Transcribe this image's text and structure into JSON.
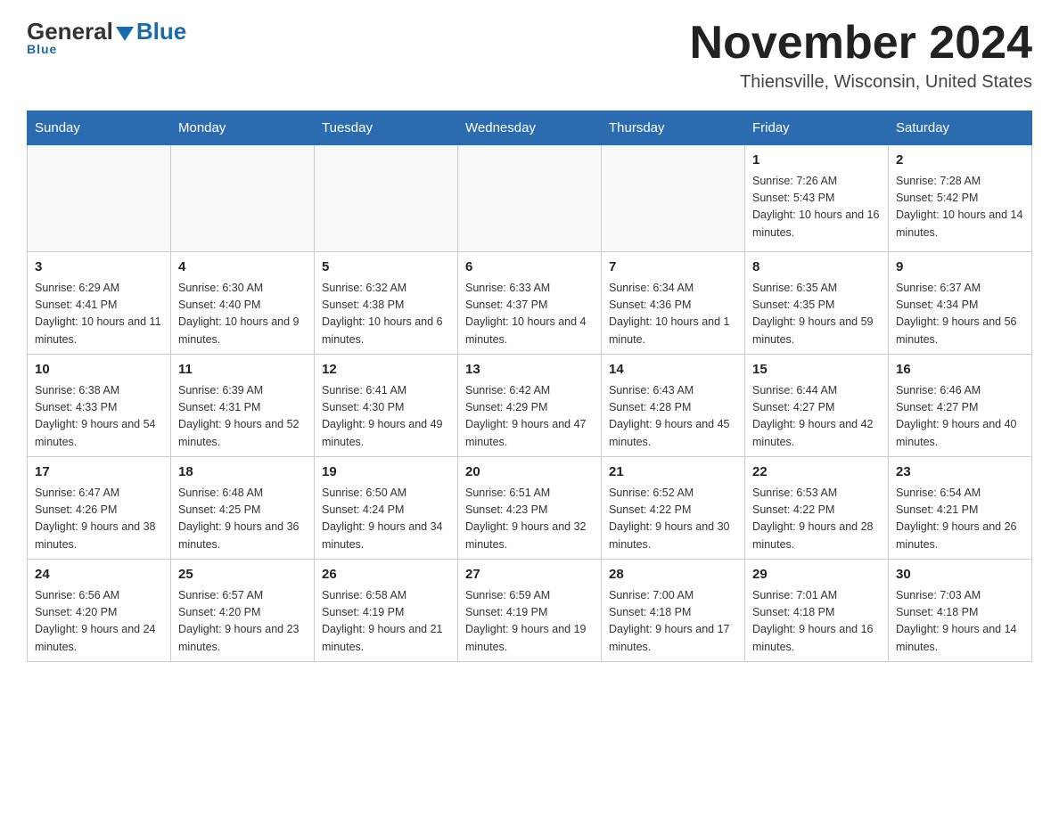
{
  "header": {
    "logo_general": "General",
    "logo_blue": "Blue",
    "month_title": "November 2024",
    "location": "Thiensville, Wisconsin, United States"
  },
  "days_of_week": [
    "Sunday",
    "Monday",
    "Tuesday",
    "Wednesday",
    "Thursday",
    "Friday",
    "Saturday"
  ],
  "weeks": [
    [
      {
        "day": "",
        "info": ""
      },
      {
        "day": "",
        "info": ""
      },
      {
        "day": "",
        "info": ""
      },
      {
        "day": "",
        "info": ""
      },
      {
        "day": "",
        "info": ""
      },
      {
        "day": "1",
        "info": "Sunrise: 7:26 AM\nSunset: 5:43 PM\nDaylight: 10 hours and 16 minutes."
      },
      {
        "day": "2",
        "info": "Sunrise: 7:28 AM\nSunset: 5:42 PM\nDaylight: 10 hours and 14 minutes."
      }
    ],
    [
      {
        "day": "3",
        "info": "Sunrise: 6:29 AM\nSunset: 4:41 PM\nDaylight: 10 hours and 11 minutes."
      },
      {
        "day": "4",
        "info": "Sunrise: 6:30 AM\nSunset: 4:40 PM\nDaylight: 10 hours and 9 minutes."
      },
      {
        "day": "5",
        "info": "Sunrise: 6:32 AM\nSunset: 4:38 PM\nDaylight: 10 hours and 6 minutes."
      },
      {
        "day": "6",
        "info": "Sunrise: 6:33 AM\nSunset: 4:37 PM\nDaylight: 10 hours and 4 minutes."
      },
      {
        "day": "7",
        "info": "Sunrise: 6:34 AM\nSunset: 4:36 PM\nDaylight: 10 hours and 1 minute."
      },
      {
        "day": "8",
        "info": "Sunrise: 6:35 AM\nSunset: 4:35 PM\nDaylight: 9 hours and 59 minutes."
      },
      {
        "day": "9",
        "info": "Sunrise: 6:37 AM\nSunset: 4:34 PM\nDaylight: 9 hours and 56 minutes."
      }
    ],
    [
      {
        "day": "10",
        "info": "Sunrise: 6:38 AM\nSunset: 4:33 PM\nDaylight: 9 hours and 54 minutes."
      },
      {
        "day": "11",
        "info": "Sunrise: 6:39 AM\nSunset: 4:31 PM\nDaylight: 9 hours and 52 minutes."
      },
      {
        "day": "12",
        "info": "Sunrise: 6:41 AM\nSunset: 4:30 PM\nDaylight: 9 hours and 49 minutes."
      },
      {
        "day": "13",
        "info": "Sunrise: 6:42 AM\nSunset: 4:29 PM\nDaylight: 9 hours and 47 minutes."
      },
      {
        "day": "14",
        "info": "Sunrise: 6:43 AM\nSunset: 4:28 PM\nDaylight: 9 hours and 45 minutes."
      },
      {
        "day": "15",
        "info": "Sunrise: 6:44 AM\nSunset: 4:27 PM\nDaylight: 9 hours and 42 minutes."
      },
      {
        "day": "16",
        "info": "Sunrise: 6:46 AM\nSunset: 4:27 PM\nDaylight: 9 hours and 40 minutes."
      }
    ],
    [
      {
        "day": "17",
        "info": "Sunrise: 6:47 AM\nSunset: 4:26 PM\nDaylight: 9 hours and 38 minutes."
      },
      {
        "day": "18",
        "info": "Sunrise: 6:48 AM\nSunset: 4:25 PM\nDaylight: 9 hours and 36 minutes."
      },
      {
        "day": "19",
        "info": "Sunrise: 6:50 AM\nSunset: 4:24 PM\nDaylight: 9 hours and 34 minutes."
      },
      {
        "day": "20",
        "info": "Sunrise: 6:51 AM\nSunset: 4:23 PM\nDaylight: 9 hours and 32 minutes."
      },
      {
        "day": "21",
        "info": "Sunrise: 6:52 AM\nSunset: 4:22 PM\nDaylight: 9 hours and 30 minutes."
      },
      {
        "day": "22",
        "info": "Sunrise: 6:53 AM\nSunset: 4:22 PM\nDaylight: 9 hours and 28 minutes."
      },
      {
        "day": "23",
        "info": "Sunrise: 6:54 AM\nSunset: 4:21 PM\nDaylight: 9 hours and 26 minutes."
      }
    ],
    [
      {
        "day": "24",
        "info": "Sunrise: 6:56 AM\nSunset: 4:20 PM\nDaylight: 9 hours and 24 minutes."
      },
      {
        "day": "25",
        "info": "Sunrise: 6:57 AM\nSunset: 4:20 PM\nDaylight: 9 hours and 23 minutes."
      },
      {
        "day": "26",
        "info": "Sunrise: 6:58 AM\nSunset: 4:19 PM\nDaylight: 9 hours and 21 minutes."
      },
      {
        "day": "27",
        "info": "Sunrise: 6:59 AM\nSunset: 4:19 PM\nDaylight: 9 hours and 19 minutes."
      },
      {
        "day": "28",
        "info": "Sunrise: 7:00 AM\nSunset: 4:18 PM\nDaylight: 9 hours and 17 minutes."
      },
      {
        "day": "29",
        "info": "Sunrise: 7:01 AM\nSunset: 4:18 PM\nDaylight: 9 hours and 16 minutes."
      },
      {
        "day": "30",
        "info": "Sunrise: 7:03 AM\nSunset: 4:18 PM\nDaylight: 9 hours and 14 minutes."
      }
    ]
  ]
}
